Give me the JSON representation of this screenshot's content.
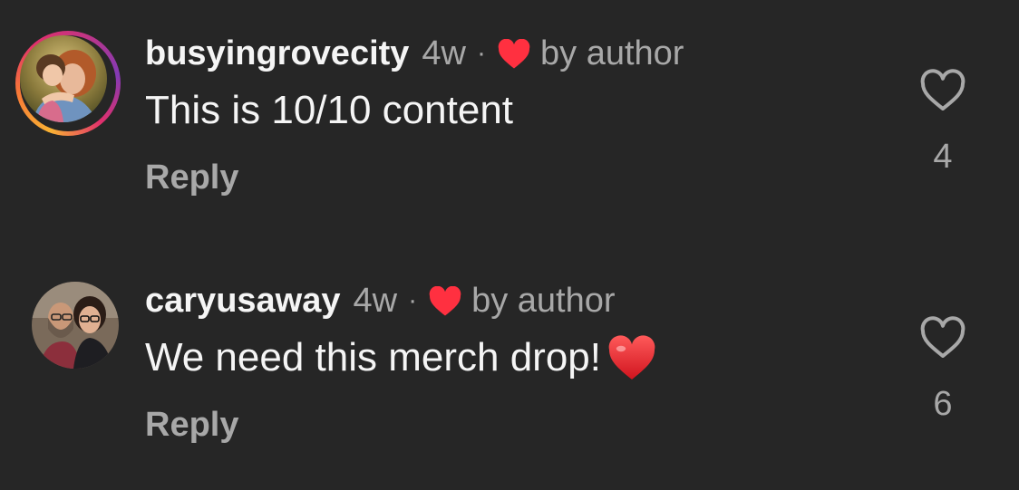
{
  "comments": [
    {
      "username": "busyingrovecity",
      "time": "4w",
      "separator": "·",
      "author_badge": "by author",
      "text": "This is 10/10 content",
      "reply_label": "Reply",
      "like_count": "4",
      "avatar_icon": "avatar-photo",
      "has_story_ring": true
    },
    {
      "username": "caryusaway",
      "time": "4w",
      "separator": "·",
      "author_badge": "by author",
      "text": "We need this merch drop!",
      "emoji": "❤️",
      "reply_label": "Reply",
      "like_count": "6",
      "avatar_icon": "avatar-photo",
      "has_story_ring": false
    }
  ],
  "colors": {
    "background": "#262626",
    "primary_text": "#f5f5f5",
    "secondary_text": "#a8a8a8",
    "heart_red": "#ff3040"
  }
}
